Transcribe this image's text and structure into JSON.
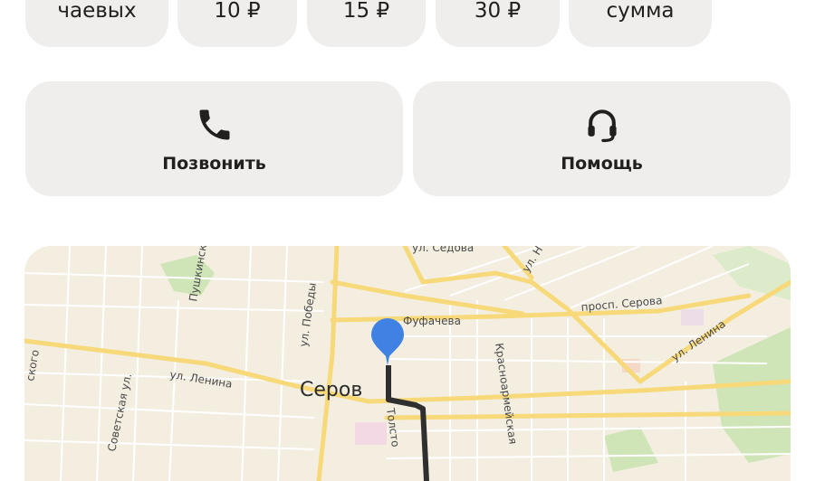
{
  "tips": [
    {
      "label": "чаевых"
    },
    {
      "label": "10 ₽"
    },
    {
      "label": "15 ₽"
    },
    {
      "label": "30 ₽"
    },
    {
      "label": "сумма"
    }
  ],
  "actions": {
    "call_label": "Позвонить",
    "help_label": "Помощь"
  },
  "map": {
    "city": "Серов",
    "streets": [
      "ул. Седова",
      "ул. Н",
      "Пушкинск",
      "ул. Победы",
      "Фуфачева",
      "просп. Серова",
      "ул. Ленина",
      "ул. Ленина",
      "Красноармейская",
      "Советская ул.",
      "Толсто",
      "ского"
    ],
    "colors": {
      "pin": "#3f82e4",
      "route": "#2f2f2f",
      "main_road": "#f7d97a",
      "park": "#cfe5b8"
    }
  }
}
